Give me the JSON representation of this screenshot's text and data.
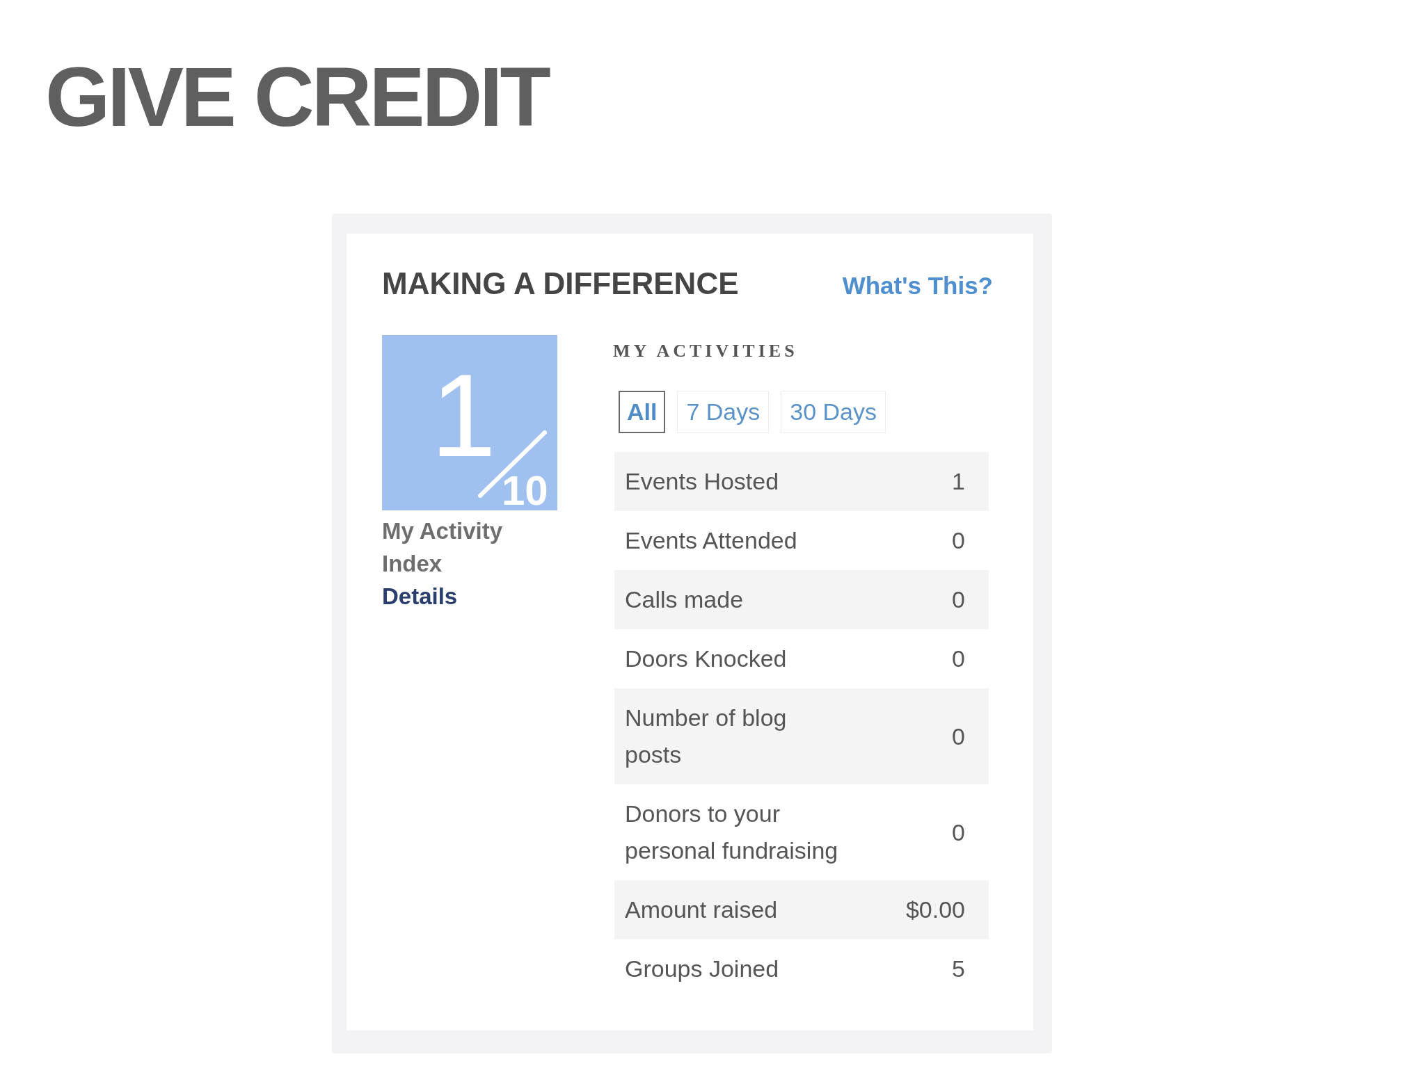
{
  "page_title": "GIVE CREDIT",
  "card": {
    "title": "MAKING A DIFFERENCE",
    "help_link": "What's This?",
    "activity_index": {
      "score": "1",
      "out_of": "10",
      "label": "My Activity Index",
      "details_link": "Details"
    },
    "activities": {
      "heading": "MY ACTIVITIES",
      "tabs": [
        {
          "label": "All",
          "selected": true
        },
        {
          "label": "7 Days",
          "selected": false
        },
        {
          "label": "30 Days",
          "selected": false
        }
      ],
      "rows": [
        {
          "label": "Events Hosted",
          "value": "1"
        },
        {
          "label": "Events Attended",
          "value": "0"
        },
        {
          "label": "Calls made",
          "value": "0"
        },
        {
          "label": "Doors Knocked",
          "value": "0"
        },
        {
          "label": "Number of blog posts",
          "value": "0"
        },
        {
          "label": "Donors to your personal fundraising",
          "value": "0"
        },
        {
          "label": "Amount raised",
          "value": "$0.00"
        },
        {
          "label": "Groups Joined",
          "value": "5"
        }
      ]
    }
  }
}
